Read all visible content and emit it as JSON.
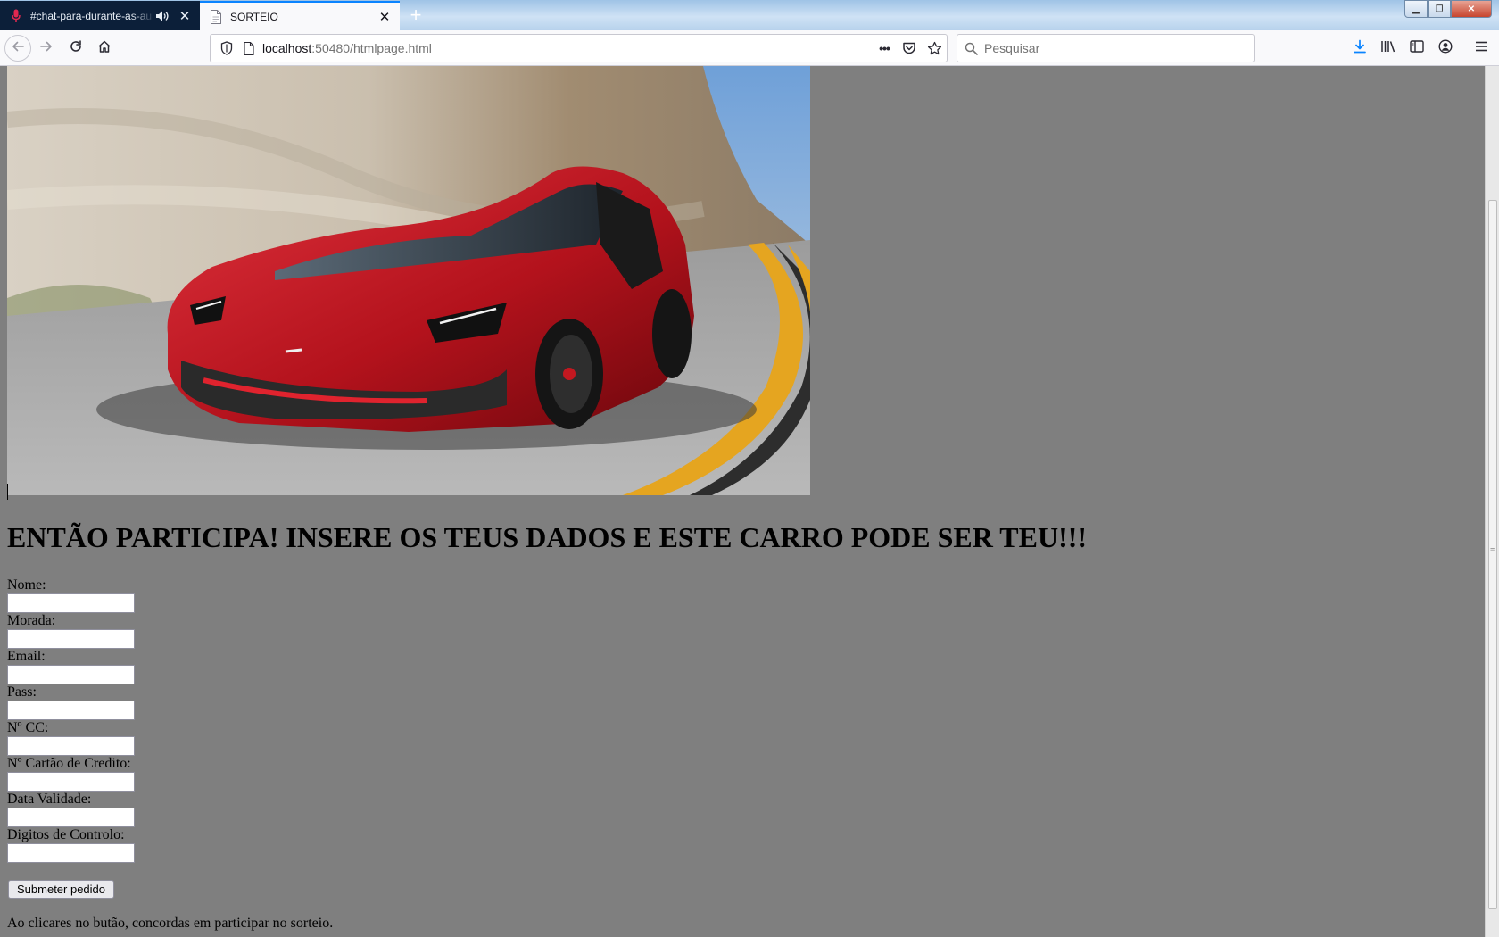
{
  "browser": {
    "tabs": [
      {
        "title": "#chat-para-durante-as-aula",
        "active": false,
        "has_audio": true
      },
      {
        "title": "SORTEIO",
        "active": true,
        "has_audio": false
      }
    ],
    "new_tab_label": "+",
    "url_host": "localhost",
    "url_rest": ":50480/htmlpage.html",
    "search_placeholder": "Pesquisar",
    "page_actions_label": "•••",
    "icons": {
      "back": "back-arrow-icon",
      "forward": "forward-arrow-icon",
      "reload": "reload-icon",
      "home": "home-icon",
      "download": "download-icon",
      "library": "library-icon",
      "sidebar": "sidebar-icon",
      "account": "account-icon",
      "menu": "hamburger-menu-icon"
    },
    "accent_color": "#0a84ff"
  },
  "page": {
    "background_color": "#7f7f7f",
    "hero_image": "red-sports-car-on-mountain-road",
    "headline": "ENTÃO PARTICIPA! INSERE OS TEUS DADOS E ESTE CARRO PODE SER TEU!!!",
    "form": {
      "fields": [
        {
          "label": "Nome:",
          "value": ""
        },
        {
          "label": "Morada:",
          "value": ""
        },
        {
          "label": "Email:",
          "value": ""
        },
        {
          "label": "Pass:",
          "value": ""
        },
        {
          "label": "Nº CC:",
          "value": ""
        },
        {
          "label": "Nº Cartão de Credito:",
          "value": ""
        },
        {
          "label": "Data Validade:",
          "value": ""
        },
        {
          "label": "Digitos de Controlo:",
          "value": ""
        }
      ],
      "submit_label": "Submeter pedido"
    },
    "disclaimer": "Ao clicares no butão, concordas em participar no sorteio."
  }
}
